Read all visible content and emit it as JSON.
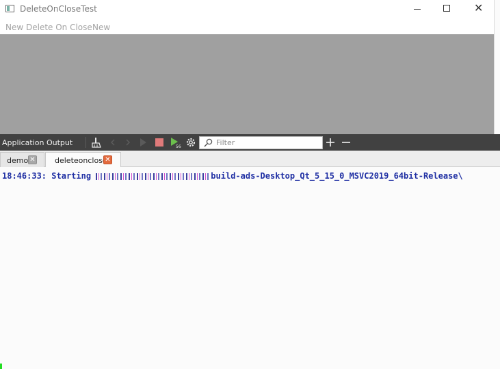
{
  "window": {
    "title": "DeleteOnCloseTest",
    "menu": [
      "New Delete On Close",
      "New"
    ]
  },
  "output_pane": {
    "title": "Application Output",
    "filter_placeholder": "Filter",
    "toolbar_icons": [
      "clean-icon",
      "prev-icon",
      "next-icon",
      "run-icon",
      "stop-icon",
      "debug-icon",
      "settings-icon",
      "plus-icon",
      "minus-icon"
    ],
    "tabs": [
      {
        "label": "demo",
        "active": false
      },
      {
        "label": "deleteonclose",
        "active": true
      }
    ],
    "log": {
      "time": "18:46:33:",
      "text": "Starting",
      "path_tail": "build-ads-Desktop_Qt_5_15_0_MSVC2019_64bit-Release\\"
    }
  },
  "colors": {
    "central_widget": "#a0a0a0",
    "toolbar": "#414141",
    "log_text": "#1f2fa3",
    "active_tab_close": "#e36a3e"
  }
}
